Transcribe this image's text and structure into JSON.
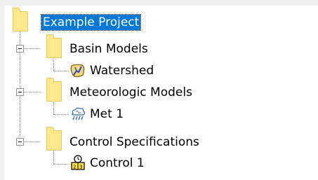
{
  "tree": {
    "root": {
      "label": "Example Project",
      "selected": true,
      "icon": "folder-icon"
    },
    "groups": [
      {
        "label": "Basin Models",
        "icon": "folder-icon",
        "expanded": true,
        "children": [
          {
            "label": "Watershed",
            "icon": "basin-model-icon"
          }
        ]
      },
      {
        "label": "Meteorologic Models",
        "icon": "folder-icon",
        "expanded": true,
        "children": [
          {
            "label": "Met 1",
            "icon": "rain-cloud-icon"
          }
        ]
      },
      {
        "label": "Control Specifications",
        "icon": "folder-icon",
        "expanded": true,
        "children": [
          {
            "label": "Control 1",
            "icon": "clock-calendar-icon"
          }
        ]
      }
    ]
  },
  "colors": {
    "selection": "#0078d7",
    "folder": "#ffe98a",
    "connector": "#8a8a8a"
  }
}
